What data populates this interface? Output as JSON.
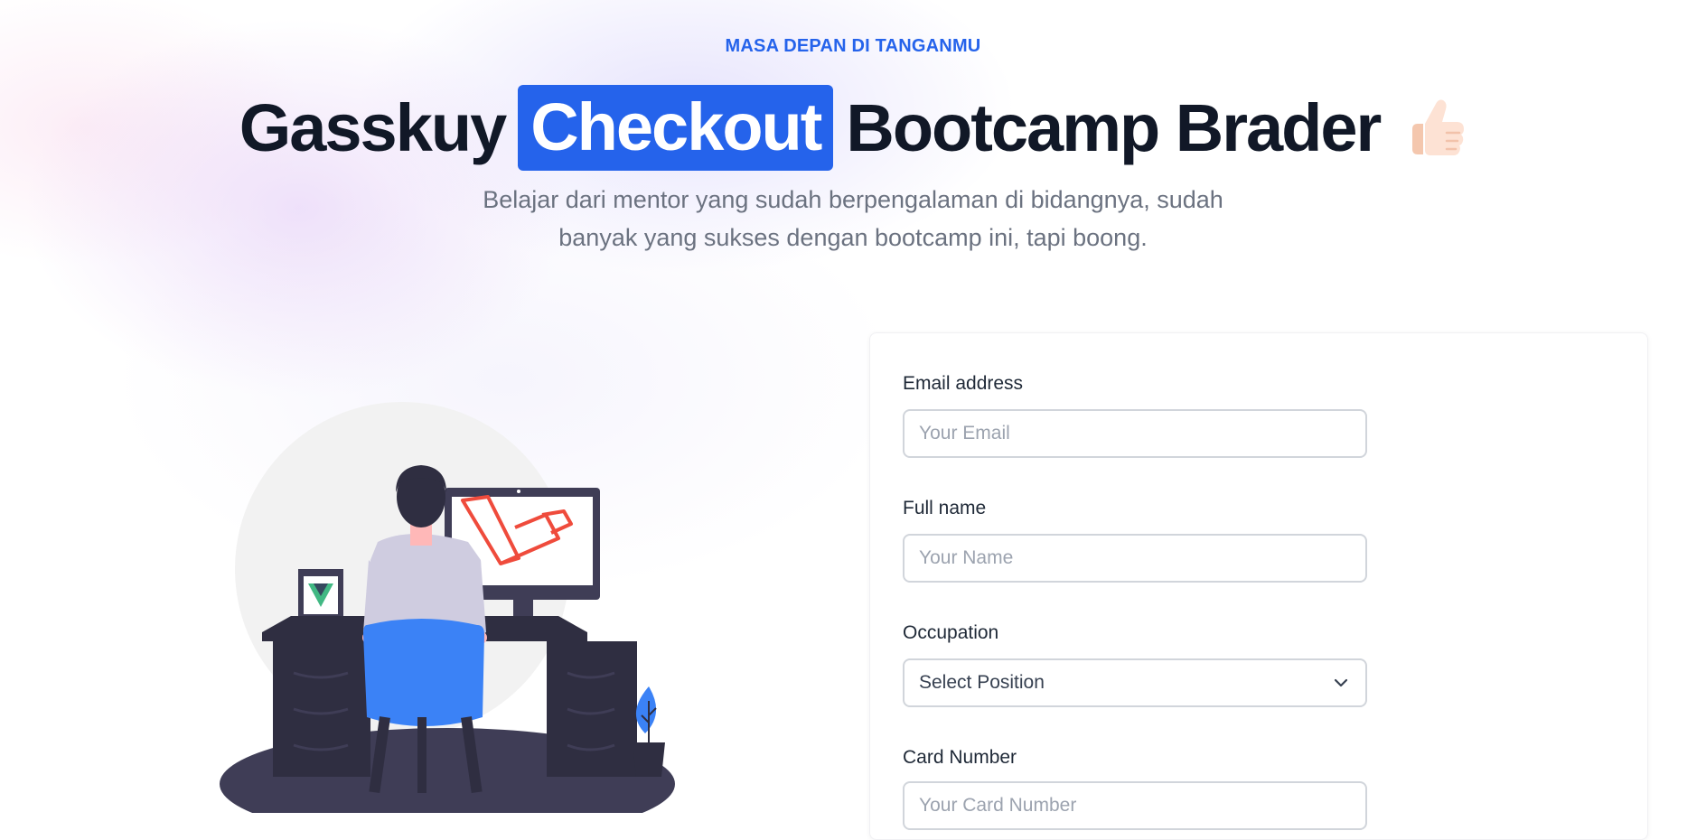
{
  "hero": {
    "eyebrow": "MASA DEPAN DI TANGANMU",
    "title_part1": "Gasskuy",
    "title_highlight": "Checkout",
    "title_part2": "Bootcamp Brader",
    "title_icon": "thumbs-up-icon",
    "subtitle_line1": "Belajar dari mentor yang sudah berpengalaman di bidangnya, sudah",
    "subtitle_line2": "banyak yang sukses dengan bootcamp ini, tapi boong."
  },
  "illustration": {
    "icon": "developer-at-desk-illustration",
    "accent": "#3b82f6",
    "logo_colors": {
      "laravel": "#ef4b3c",
      "vue_green": "#41b883",
      "vue_dark": "#35495e"
    }
  },
  "form": {
    "email": {
      "label": "Email address",
      "placeholder": "Your Email"
    },
    "name": {
      "label": "Full name",
      "placeholder": "Your Name"
    },
    "occupation": {
      "label": "Occupation",
      "selected": "Select Position",
      "icon": "chevron-down-icon"
    },
    "card": {
      "label": "Card Number",
      "placeholder": "Your Card Number"
    }
  },
  "colors": {
    "brand": "#2563eb",
    "heading": "#111827",
    "muted": "#6b7280",
    "input_border": "#d1d5db"
  }
}
